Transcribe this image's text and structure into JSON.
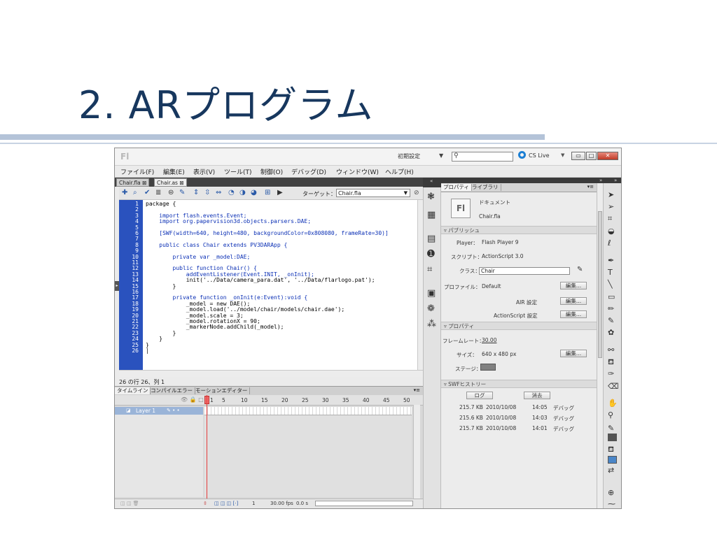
{
  "slide": {
    "title": "2. ARプログラム"
  },
  "window": {
    "app_logo": "Fl",
    "workspace": "初期設定",
    "workspace_chevron": "▼",
    "search_placeholder": "",
    "cs_live": "CS Live",
    "controls": {
      "minimize": "▭",
      "maximize": "□",
      "close": "✕"
    }
  },
  "menu": [
    "ファイル(F)",
    "編集(E)",
    "表示(V)",
    "ツール(T)",
    "制御(O)",
    "デバッグ(D)",
    "ウィンドウ(W)",
    "ヘルプ(H)"
  ],
  "doc_tabs": [
    "Chair.fla ⊠",
    "Chair.as ⊠"
  ],
  "code_toolbar": {
    "target_label": "ターゲット：",
    "target_value": "Chair.fla"
  },
  "code": {
    "line_numbers": [
      "1",
      "2",
      "3",
      "4",
      "5",
      "6",
      "7",
      "8",
      "9",
      "10",
      "11",
      "12",
      "13",
      "14",
      "15",
      "16",
      "17",
      "18",
      "19",
      "20",
      "21",
      "22",
      "23",
      "24",
      "25",
      "26"
    ],
    "lines": [
      "package {",
      "",
      "    import flash.events.Event;",
      "    import org.papervision3d.objects.parsers.DAE;",
      "",
      "    [SWF(width=640, height=480, backgroundColor=0x808080, frameRate=30)]",
      "",
      "    public class Chair extends PV3DARApp {",
      "",
      "        private var _model:DAE;",
      "",
      "        public function Chair() {",
      "            addEventListener(Event.INIT, _onInit);",
      "            init('../Data/camera_para.dat', '../Data/flarlogo.pat');",
      "        }",
      "",
      "        private function _onInit(e:Event):void {",
      "            _model = new DAE();",
      "            _model.load('../model/chair/models/chair.dae');",
      "            _model.scale = 3;",
      "            _model.rotationX = 90;",
      "            _markerNode.addChild(_model);",
      "        }",
      "    }",
      "}",
      "|"
    ],
    "status": "26 の行 26、列 1"
  },
  "bottom_tabs": [
    "タイムライン",
    "コンパイルエラー",
    "モーションエディター"
  ],
  "timeline": {
    "frame_numbers": [
      "1",
      "5",
      "10",
      "15",
      "20",
      "25",
      "30",
      "35",
      "40",
      "45",
      "50"
    ],
    "layer_name": "Layer 1",
    "header_icons": "👁 🔒 □",
    "frame_index": "1",
    "fps": "30.00 fps",
    "time": "0.0 s"
  },
  "properties": {
    "tabs": [
      "プロパティ",
      "ライブラリ"
    ],
    "doc_type": "ドキュメント",
    "doc_name": "Chair.fla",
    "publish_section": "パブリッシュ",
    "player_label": "Player：",
    "player_value": "Flash Player 9",
    "script_label": "スクリプト：",
    "script_value": "ActionScript 3.0",
    "class_label": "クラス：",
    "class_value": "Chair",
    "profile_label": "プロファイル：",
    "profile_value": "Default",
    "edit_label": "編集...",
    "air_label": "AIR 設定",
    "as_label": "ActionScript 設定",
    "props_section": "プロパティ",
    "framerate_label": "フレームレート：",
    "framerate_value": "30.00",
    "size_label": "サイズ：",
    "size_value": "640 x 480 px",
    "stage_label": "ステージ：",
    "stage_color": "#808080",
    "history_section": "SWFヒストリー",
    "log_btn": "ログ",
    "clear_btn": "消去",
    "history": [
      {
        "size": "215.7 KB",
        "date": "2010/10/08",
        "time": "14:05",
        "type": "デバッグ"
      },
      {
        "size": "215.6 KB",
        "date": "2010/10/08",
        "time": "14:03",
        "type": "デバッグ"
      },
      {
        "size": "215.7 KB",
        "date": "2010/10/08",
        "time": "14:01",
        "type": "デバッグ"
      }
    ]
  },
  "colors": {
    "gutter": "#2a52be",
    "title": "#17375e",
    "stroke_swatch": "#555555",
    "fill_swatch": "#4a86c8"
  }
}
